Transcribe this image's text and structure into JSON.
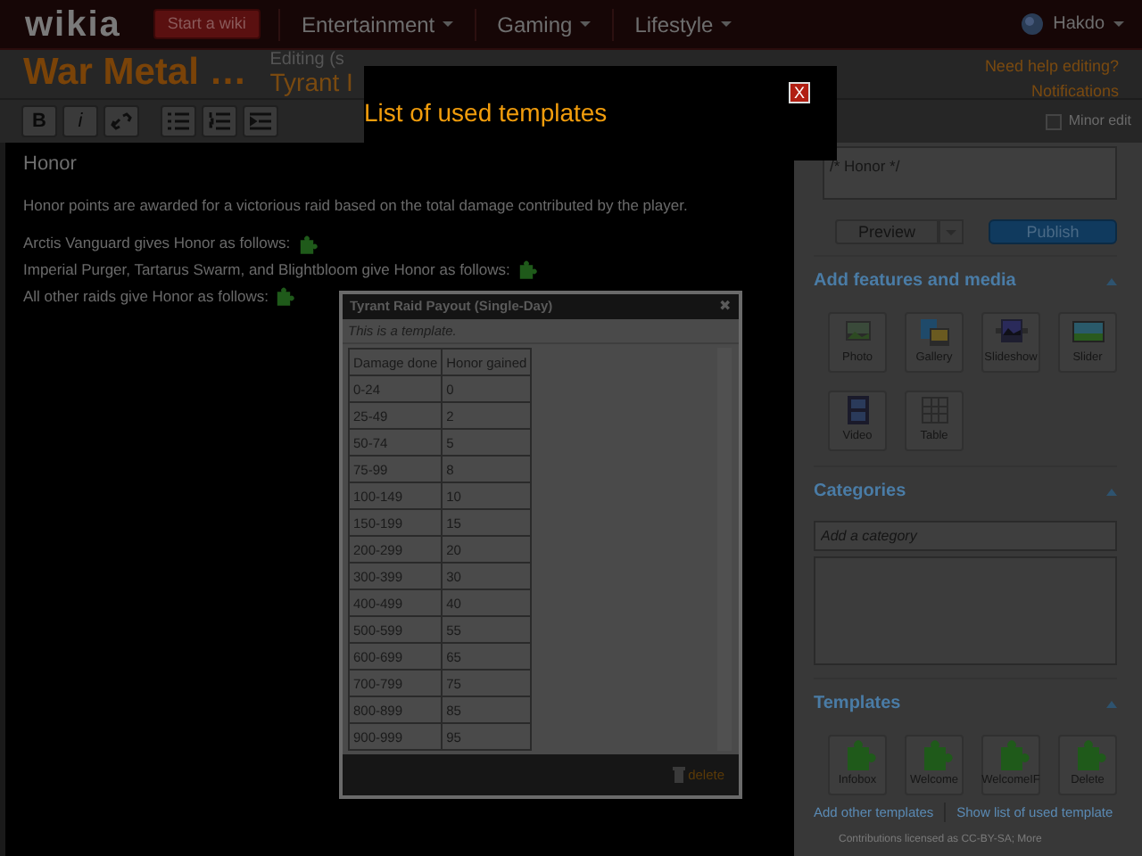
{
  "top_nav": {
    "logo": "wikia",
    "start_button": "Start a wiki",
    "menus": [
      "Entertainment",
      "Gaming",
      "Lifestyle"
    ],
    "user": "Hakdo"
  },
  "header": {
    "wiki_title": "War Metal …",
    "editing_label": "Editing (s",
    "page_title": "Tyrant I",
    "help_links": [
      "Need help editing?",
      "Notifications"
    ]
  },
  "toolbar": {
    "format_buttons": [
      "B",
      "i"
    ],
    "minor_edit": {
      "label": "Minor edit",
      "checked": false
    }
  },
  "article": {
    "heading": "Honor",
    "intro": "Honor points are awarded for a victorious raid based on the total damage contributed by the player.",
    "segments": [
      "Arctis Vanguard gives Honor as follows:",
      "Imperial Purger, Tartarus Swarm, and Blightbloom give Honor as follows:",
      "All other raids give Honor as follows:"
    ]
  },
  "sidebar": {
    "summary": "/* Honor */",
    "preview": "Preview",
    "publish": "Publish",
    "features": {
      "title": "Add features and media",
      "items": [
        {
          "label": "Photo",
          "kind": "photo"
        },
        {
          "label": "Gallery",
          "kind": "gallery"
        },
        {
          "label": "Slideshow",
          "kind": "slideshow"
        },
        {
          "label": "Slider",
          "kind": "slider"
        },
        {
          "label": "Video",
          "kind": "video"
        },
        {
          "label": "Table",
          "kind": "table"
        }
      ]
    },
    "categories": {
      "title": "Categories",
      "placeholder": "Add a category"
    },
    "templates": {
      "title": "Templates",
      "items": [
        "Infobox",
        "Welcome",
        "WelcomeIF",
        "Delete"
      ],
      "links": [
        "Add other templates",
        "Show list of used template"
      ]
    },
    "footer_text": "Contributions licensed as CC-BY-SA;",
    "footer_link": "More"
  },
  "modal": {
    "title": "List of used templates",
    "close": "X"
  },
  "template_popup": {
    "title": "Tyrant Raid Payout (Single-Day)",
    "close": "✖",
    "note": "This is a template.",
    "columns": [
      "Damage done",
      "Honor gained"
    ],
    "rows": [
      [
        "0-24",
        "0"
      ],
      [
        "25-49",
        "2"
      ],
      [
        "50-74",
        "5"
      ],
      [
        "75-99",
        "8"
      ],
      [
        "100-149",
        "10"
      ],
      [
        "150-199",
        "15"
      ],
      [
        "200-299",
        "20"
      ],
      [
        "300-399",
        "30"
      ],
      [
        "400-499",
        "40"
      ],
      [
        "500-599",
        "55"
      ],
      [
        "600-699",
        "65"
      ],
      [
        "700-799",
        "75"
      ],
      [
        "800-899",
        "85"
      ],
      [
        "900-999",
        "95"
      ]
    ],
    "delete": "delete"
  }
}
